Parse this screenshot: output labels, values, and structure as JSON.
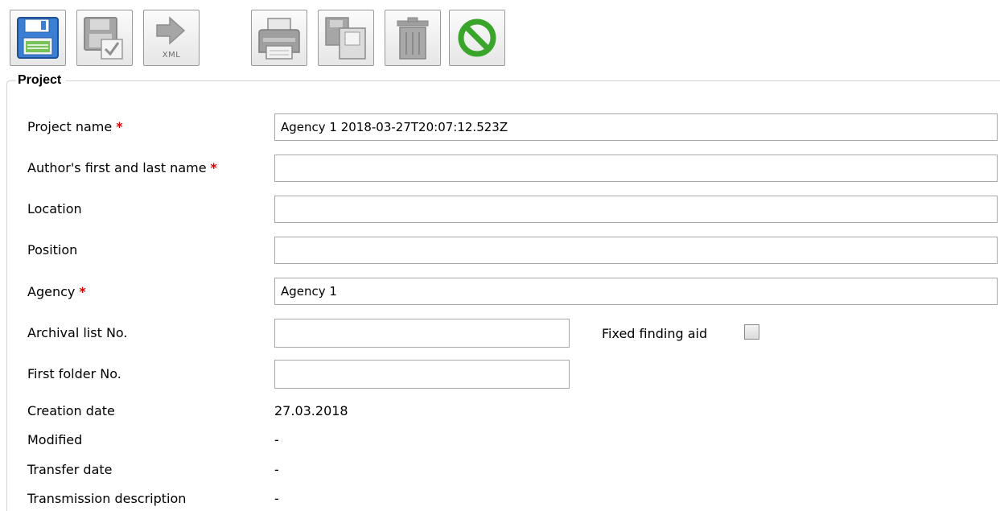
{
  "toolbar": {
    "buttons": [
      {
        "name": "save",
        "icon": "floppy-disk-icon",
        "enabled": true
      },
      {
        "name": "save-validate",
        "icon": "save-check-icon",
        "enabled": false
      },
      {
        "name": "export-xml",
        "icon": "arrow-right-icon",
        "label": "XML",
        "enabled": false
      },
      {
        "name": "print",
        "icon": "printer-icon",
        "enabled": false
      },
      {
        "name": "copy",
        "icon": "copy-icon",
        "enabled": false
      },
      {
        "name": "delete",
        "icon": "trash-icon",
        "enabled": false
      },
      {
        "name": "cancel",
        "icon": "no-entry-icon",
        "enabled": true
      }
    ]
  },
  "group_title": "Project",
  "form": {
    "project_name": {
      "label": "Project name",
      "required": true,
      "value": "Agency 1 2018-03-27T20:07:12.523Z"
    },
    "author_name": {
      "label": "Author's first and last name",
      "required": true,
      "value": ""
    },
    "location": {
      "label": "Location",
      "value": ""
    },
    "position": {
      "label": "Position",
      "value": ""
    },
    "agency": {
      "label": "Agency",
      "required": true,
      "value": "Agency 1"
    },
    "archival_list_no": {
      "label": "Archival list No.",
      "value": ""
    },
    "fixed_finding_aid": {
      "label": "Fixed finding aid",
      "checked": false
    },
    "first_folder_no": {
      "label": "First folder No.",
      "value": ""
    },
    "creation_date": {
      "label": "Creation date",
      "value": "27.03.2018"
    },
    "modified": {
      "label": "Modified",
      "value": "-"
    },
    "transfer_date": {
      "label": "Transfer date",
      "value": "-"
    },
    "transmission_description": {
      "label": "Transmission description",
      "value": "-"
    }
  },
  "colors": {
    "required_marker": "#e00000",
    "save_icon_blue": "#3b7fd4",
    "cancel_icon_green": "#3aa52b",
    "disabled_icon_gray": "#a6a6a6"
  }
}
